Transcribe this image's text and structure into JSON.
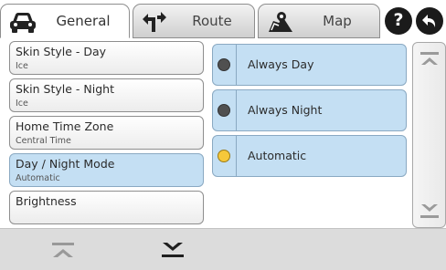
{
  "tabs": [
    {
      "label": "General",
      "icon": "car-icon",
      "active": true
    },
    {
      "label": "Route",
      "icon": "turn-arrow-icon",
      "active": false
    },
    {
      "label": "Map",
      "icon": "map-pin-icon",
      "active": false
    }
  ],
  "header_buttons": {
    "help": "?",
    "back_icon": "back-arrow-icon"
  },
  "settings": [
    {
      "title": "Skin Style - Day",
      "value": "Ice"
    },
    {
      "title": "Skin Style - Night",
      "value": "Ice"
    },
    {
      "title": "Home Time Zone",
      "value": "Central Time"
    },
    {
      "title": "Day / Night Mode",
      "value": "Automatic"
    },
    {
      "title": "Brightness",
      "value": ""
    }
  ],
  "options": [
    {
      "label": "Always Day",
      "selected": false
    },
    {
      "label": "Always Night",
      "selected": false
    },
    {
      "label": "Automatic",
      "selected": true
    }
  ],
  "scroll_icons": {
    "up": "scroll-up-icon",
    "down": "scroll-down-icon"
  },
  "bottom_icons": {
    "left": "page-top-icon",
    "right": "page-bottom-icon"
  },
  "colors": {
    "selected_bg": "#c4dff3",
    "radio_on": "#f6c83a",
    "radio_off": "#505050",
    "help_button": "#1b1b1b"
  }
}
